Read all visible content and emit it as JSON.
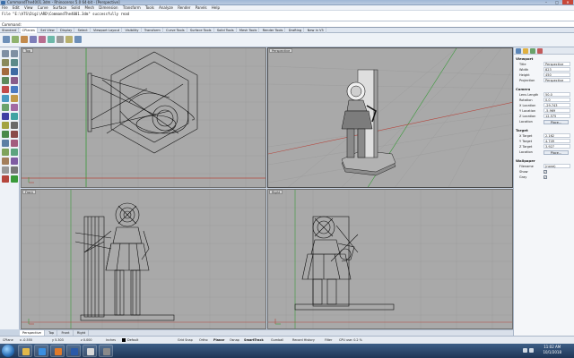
{
  "window": {
    "title": "CommandThe4001.3dm - Rhinoceros 5.0 64-bit - [Perspective]",
    "controls": [
      "–",
      "□",
      "✕"
    ]
  },
  "menubar": {
    "items": [
      "File",
      "Edit",
      "View",
      "Curve",
      "Surface",
      "Solid",
      "Mesh",
      "Dimension",
      "Transform",
      "Tools",
      "Analyze",
      "Render",
      "Panels",
      "Help"
    ]
  },
  "command_history": {
    "line1": "File \"E:\\ATS\\Digi\\ARD\\CommandThe4001.3dm\" successfully read"
  },
  "command": {
    "label": "Command:",
    "value": ""
  },
  "tabs": [
    "Standard",
    "CPlanes",
    "Set View",
    "Display",
    "Select",
    "Viewport Layout",
    "Visibility",
    "Transform",
    "Curve Tools",
    "Surface Tools",
    "Solid Tools",
    "Mesh Tools",
    "Render Tools",
    "Drafting",
    "New in V5"
  ],
  "active_tab": "CPlanes",
  "viewports": {
    "top": {
      "label": "Top"
    },
    "perspective": {
      "label": "Perspective"
    },
    "front": {
      "label": "Front"
    },
    "right": {
      "label": "Right"
    }
  },
  "viewport_tabs": [
    "Perspective",
    "Top",
    "Front",
    "Right"
  ],
  "active_viewport_tab": "Perspective",
  "properties": {
    "sections": {
      "viewport": "Viewport",
      "camera": "Camera",
      "target": "Target",
      "wallpaper": "Wallpaper"
    },
    "viewport_rows": [
      {
        "label": "Title",
        "value": "Perspective"
      },
      {
        "label": "Width",
        "value": "823"
      },
      {
        "label": "Height",
        "value": "450"
      },
      {
        "label": "Projection",
        "value": "Perspective"
      }
    ],
    "camera_rows": [
      {
        "label": "Lens Length",
        "value": "50.0"
      },
      {
        "label": "Rotation",
        "value": "0.0"
      },
      {
        "label": "X Location",
        "value": "-29.743"
      },
      {
        "label": "Y Location",
        "value": "-5.969"
      },
      {
        "label": "Z Location",
        "value": "12.575"
      }
    ],
    "camera_location_label": "Location",
    "camera_place_button": "Place...",
    "target_rows": [
      {
        "label": "X Target",
        "value": "2.162"
      },
      {
        "label": "Y Target",
        "value": "4.749"
      },
      {
        "label": "Z Target",
        "value": "3.927"
      }
    ],
    "target_location_label": "Location",
    "target_place_button": "Place...",
    "wallpaper_rows": [
      {
        "label": "Filename",
        "value": "(none)"
      }
    ],
    "wallpaper_checks": [
      {
        "label": "Show",
        "checked": "✓"
      },
      {
        "label": "Gray",
        "checked": "✓"
      }
    ]
  },
  "status": {
    "cplane": "CPlane",
    "x": "x -0.555",
    "y": "y 5.303",
    "z": "z 0.000",
    "units": "Inches",
    "layer": "Default",
    "toggles": [
      "Grid Snap",
      "Ortho",
      "Planar",
      "Osnap",
      "SmartTrack",
      "Gumball",
      "Record History",
      "Filter"
    ],
    "cpu": "CPU use: 0.2 %"
  },
  "taskbar": {
    "time": "11:02 AM",
    "date": "10/1/2018"
  },
  "colors": {
    "viewport_bg": "#a9a9a9",
    "active_viewport_border": "#6f6f6f",
    "grid": "#9a9a9a",
    "x_axis": "#b5463d",
    "y_axis": "#3a9a3a",
    "wire": "#111111"
  },
  "icons": {
    "start": "windows-start-orb",
    "taskbar_apps": [
      "explorer-icon",
      "ie-icon",
      "media-player-icon",
      "word-icon",
      "rhino-icon",
      "app-icon"
    ],
    "right_panel": [
      "properties-icon",
      "layers-icon",
      "display-icon",
      "help-icon"
    ]
  }
}
